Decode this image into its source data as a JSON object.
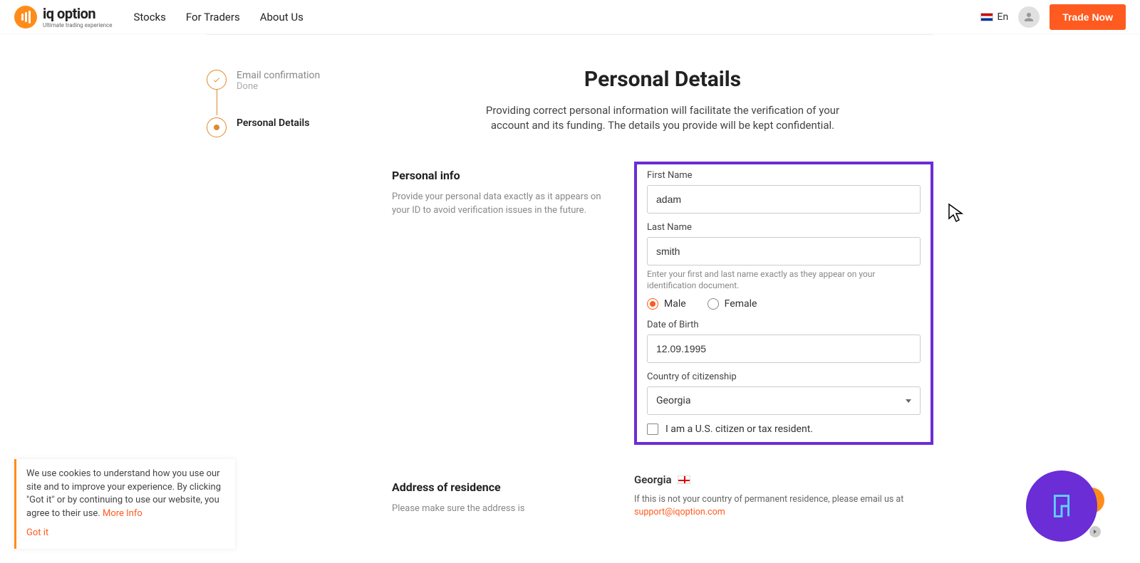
{
  "header": {
    "brand": "iq option",
    "tagline": "Ultimate trading experience",
    "nav": {
      "stocks": "Stocks",
      "for_traders": "For Traders",
      "about": "About Us"
    },
    "lang": "En",
    "trade_btn": "Trade Now"
  },
  "progress": {
    "step1": {
      "title": "Email confirmation",
      "status": "Done"
    },
    "step2": {
      "title": "Personal Details"
    }
  },
  "page": {
    "title": "Personal Details",
    "subtitle": "Providing correct personal information will facilitate the verification of your account and its funding. The details you provide will be kept confidential."
  },
  "personal_info": {
    "heading": "Personal info",
    "desc": "Provide your personal data exactly as it appears on your ID to avoid verification issues in the future.",
    "first_name_label": "First Name",
    "first_name_value": "adam",
    "last_name_label": "Last Name",
    "last_name_value": "smith",
    "name_helper": "Enter your first and last name exactly as they appear on your identification document.",
    "male": "Male",
    "female": "Female",
    "dob_label": "Date of Birth",
    "dob_value": "12.09.1995",
    "country_label": "Country of citizenship",
    "country_value": "Georgia",
    "us_citizen": "I am a U.S. citizen or tax resident."
  },
  "address": {
    "heading": "Address of residence",
    "desc": "Please make sure the address is",
    "country": "Georgia",
    "note": "If this is not your country of permanent residence, please email us at",
    "email": "support@iqoption.com"
  },
  "cookie": {
    "text": "We use cookies to understand how you use our site and to improve your experience. By clicking \"Got it\" or by continuing to use our website, you agree to their use.",
    "more": "More Info",
    "gotit": "Got it"
  }
}
